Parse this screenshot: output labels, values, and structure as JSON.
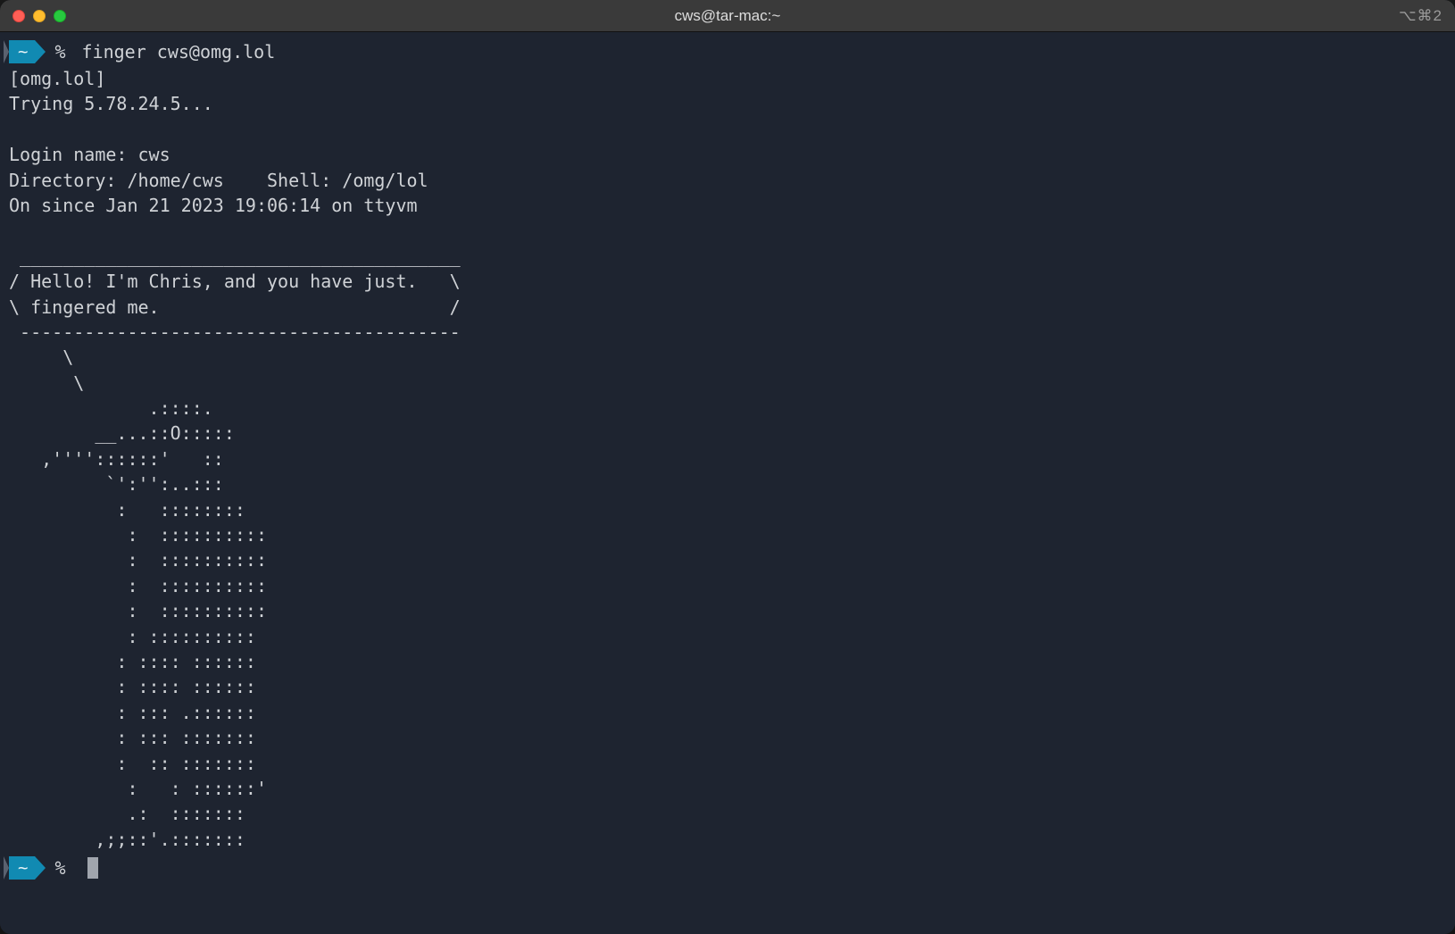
{
  "window": {
    "title": "cws@tar-mac:~",
    "right_indicator": "⌥⌘2"
  },
  "prompt": {
    "badge": "~",
    "symbol": "%"
  },
  "command": "finger cws@omg.lol",
  "output_lines": [
    "[omg.lol]",
    "Trying 5.78.24.5...",
    "",
    "Login name: cws",
    "Directory: /home/cws    Shell: /omg/lol",
    "On since Jan 21 2023 19:06:14 on ttyvm",
    "",
    " _________________________________________",
    "/ Hello! I'm Chris, and you have just.   \\",
    "\\ fingered me.                           /",
    " -----------------------------------------",
    "     \\",
    "      \\",
    "             .::::.",
    "        __...::O:::::",
    "   ,''''::::::'   ::",
    "         `':'':..:::",
    "          :   ::::::::",
    "           :  ::::::::::",
    "           :  ::::::::::",
    "           :  ::::::::::",
    "           :  ::::::::::",
    "           : ::::::::::",
    "          : :::: ::::::",
    "          : :::: ::::::",
    "          : ::: .::::::",
    "          : ::: :::::::",
    "          :  :: :::::::",
    "           :   : ::::::'",
    "           .:  :::::::",
    "        ,;;::'.:::::::"
  ]
}
